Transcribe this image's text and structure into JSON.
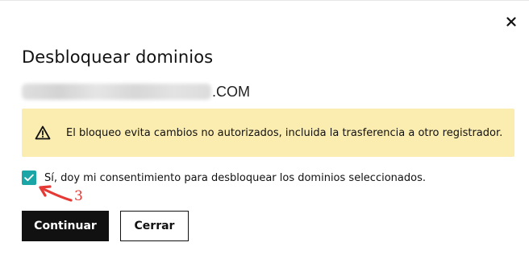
{
  "dialog": {
    "title": "Desbloquear dominios",
    "close_icon": "close-icon",
    "domain": {
      "tld": ".COM"
    },
    "warning": {
      "icon": "warning-icon",
      "text": "El bloqueo evita cambios no autorizados, incluida la trasferencia a otro registrador."
    },
    "consent": {
      "checked": true,
      "label": "Sí, doy mi consentimiento para desbloquear los dominios seleccionados."
    },
    "buttons": {
      "continue_label": "Continuar",
      "close_label": "Cerrar"
    }
  },
  "annotation": {
    "number": "3",
    "color": "#e53935"
  },
  "colors": {
    "warning_bg": "#fbecb0",
    "checkbox": "#1aa6a6",
    "primary_button": "#111111"
  }
}
